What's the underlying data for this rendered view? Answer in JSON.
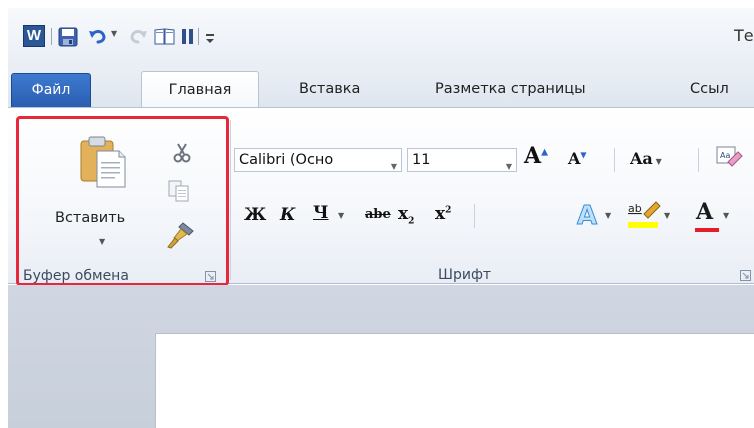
{
  "window": {
    "title": "Те"
  },
  "quick_access": {
    "app_icon_letter": "W",
    "save_icon": "save-icon",
    "undo_icon": "undo-icon",
    "redo_icon": "redo-icon",
    "customize_icon": "customize-icon"
  },
  "tabs": [
    {
      "label": "Файл"
    },
    {
      "label": "Главная"
    },
    {
      "label": "Вставка"
    },
    {
      "label": "Разметка страницы"
    },
    {
      "label": "Ссыл"
    }
  ],
  "clipboard": {
    "paste_label": "Вставить",
    "group_title": "Буфер обмена",
    "highlight_color": "#e8283a"
  },
  "font": {
    "font_name": "Calibri (Осно",
    "font_size": "11",
    "grow_label": "A",
    "shrink_label": "A",
    "change_case_label": "Aa",
    "bold_label": "Ж",
    "italic_label": "К",
    "underline_label": "Ч",
    "strike_label": "abe",
    "subscript_label": "x",
    "superscript_label": "x",
    "color_label": "A",
    "group_title": "Шрифт",
    "font_color": "#e41e26",
    "highlight_color": "#ffff00"
  },
  "colors": {
    "file_tab": "#2a5db0",
    "ribbon_border": "#b7c4d6",
    "workspace": "#cdd5e0"
  }
}
